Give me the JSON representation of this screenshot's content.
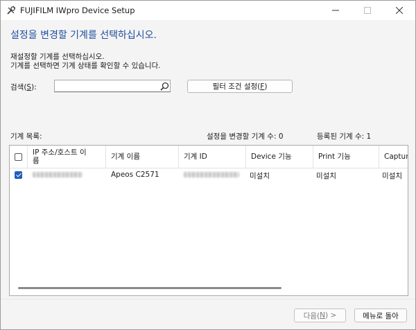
{
  "window": {
    "title": "FUJIFILM IWpro Device Setup"
  },
  "heading": "설정을 변경할 기계를 선택하십시오.",
  "description": {
    "line1": "재설정할 기계를 선택하십시오.",
    "line2": "기계를 선택하면 기계 상태를 확인할 수 있습니다."
  },
  "search": {
    "label_prefix": "검색(",
    "label_key": "S",
    "label_suffix": "):",
    "value": ""
  },
  "filter_button": {
    "prefix": "필터 조건 설정(",
    "key": "F",
    "suffix": ")"
  },
  "list": {
    "label": "기계 목록:",
    "change_count_label": "설정을 변경할 기계 수:",
    "change_count": "0",
    "registered_count_label": "등록된 기계 수:",
    "registered_count": "1",
    "columns": [
      {
        "line1": "IP 주소/호스트 이",
        "line2": "름"
      },
      {
        "line1": "기계 이름"
      },
      {
        "line1": "기계 ID"
      },
      {
        "line1": "Device 기능"
      },
      {
        "line1": "Print 기능"
      },
      {
        "line1": "Capture"
      }
    ],
    "rows": [
      {
        "checked": true,
        "machine_name": "Apeos C2571",
        "device": "미설치",
        "print": "미설치",
        "capture": "미설치"
      }
    ]
  },
  "footer": {
    "next": {
      "prefix": "다음(",
      "key": "N",
      "suffix": ") >"
    },
    "menu": "메뉴로 돌아"
  }
}
